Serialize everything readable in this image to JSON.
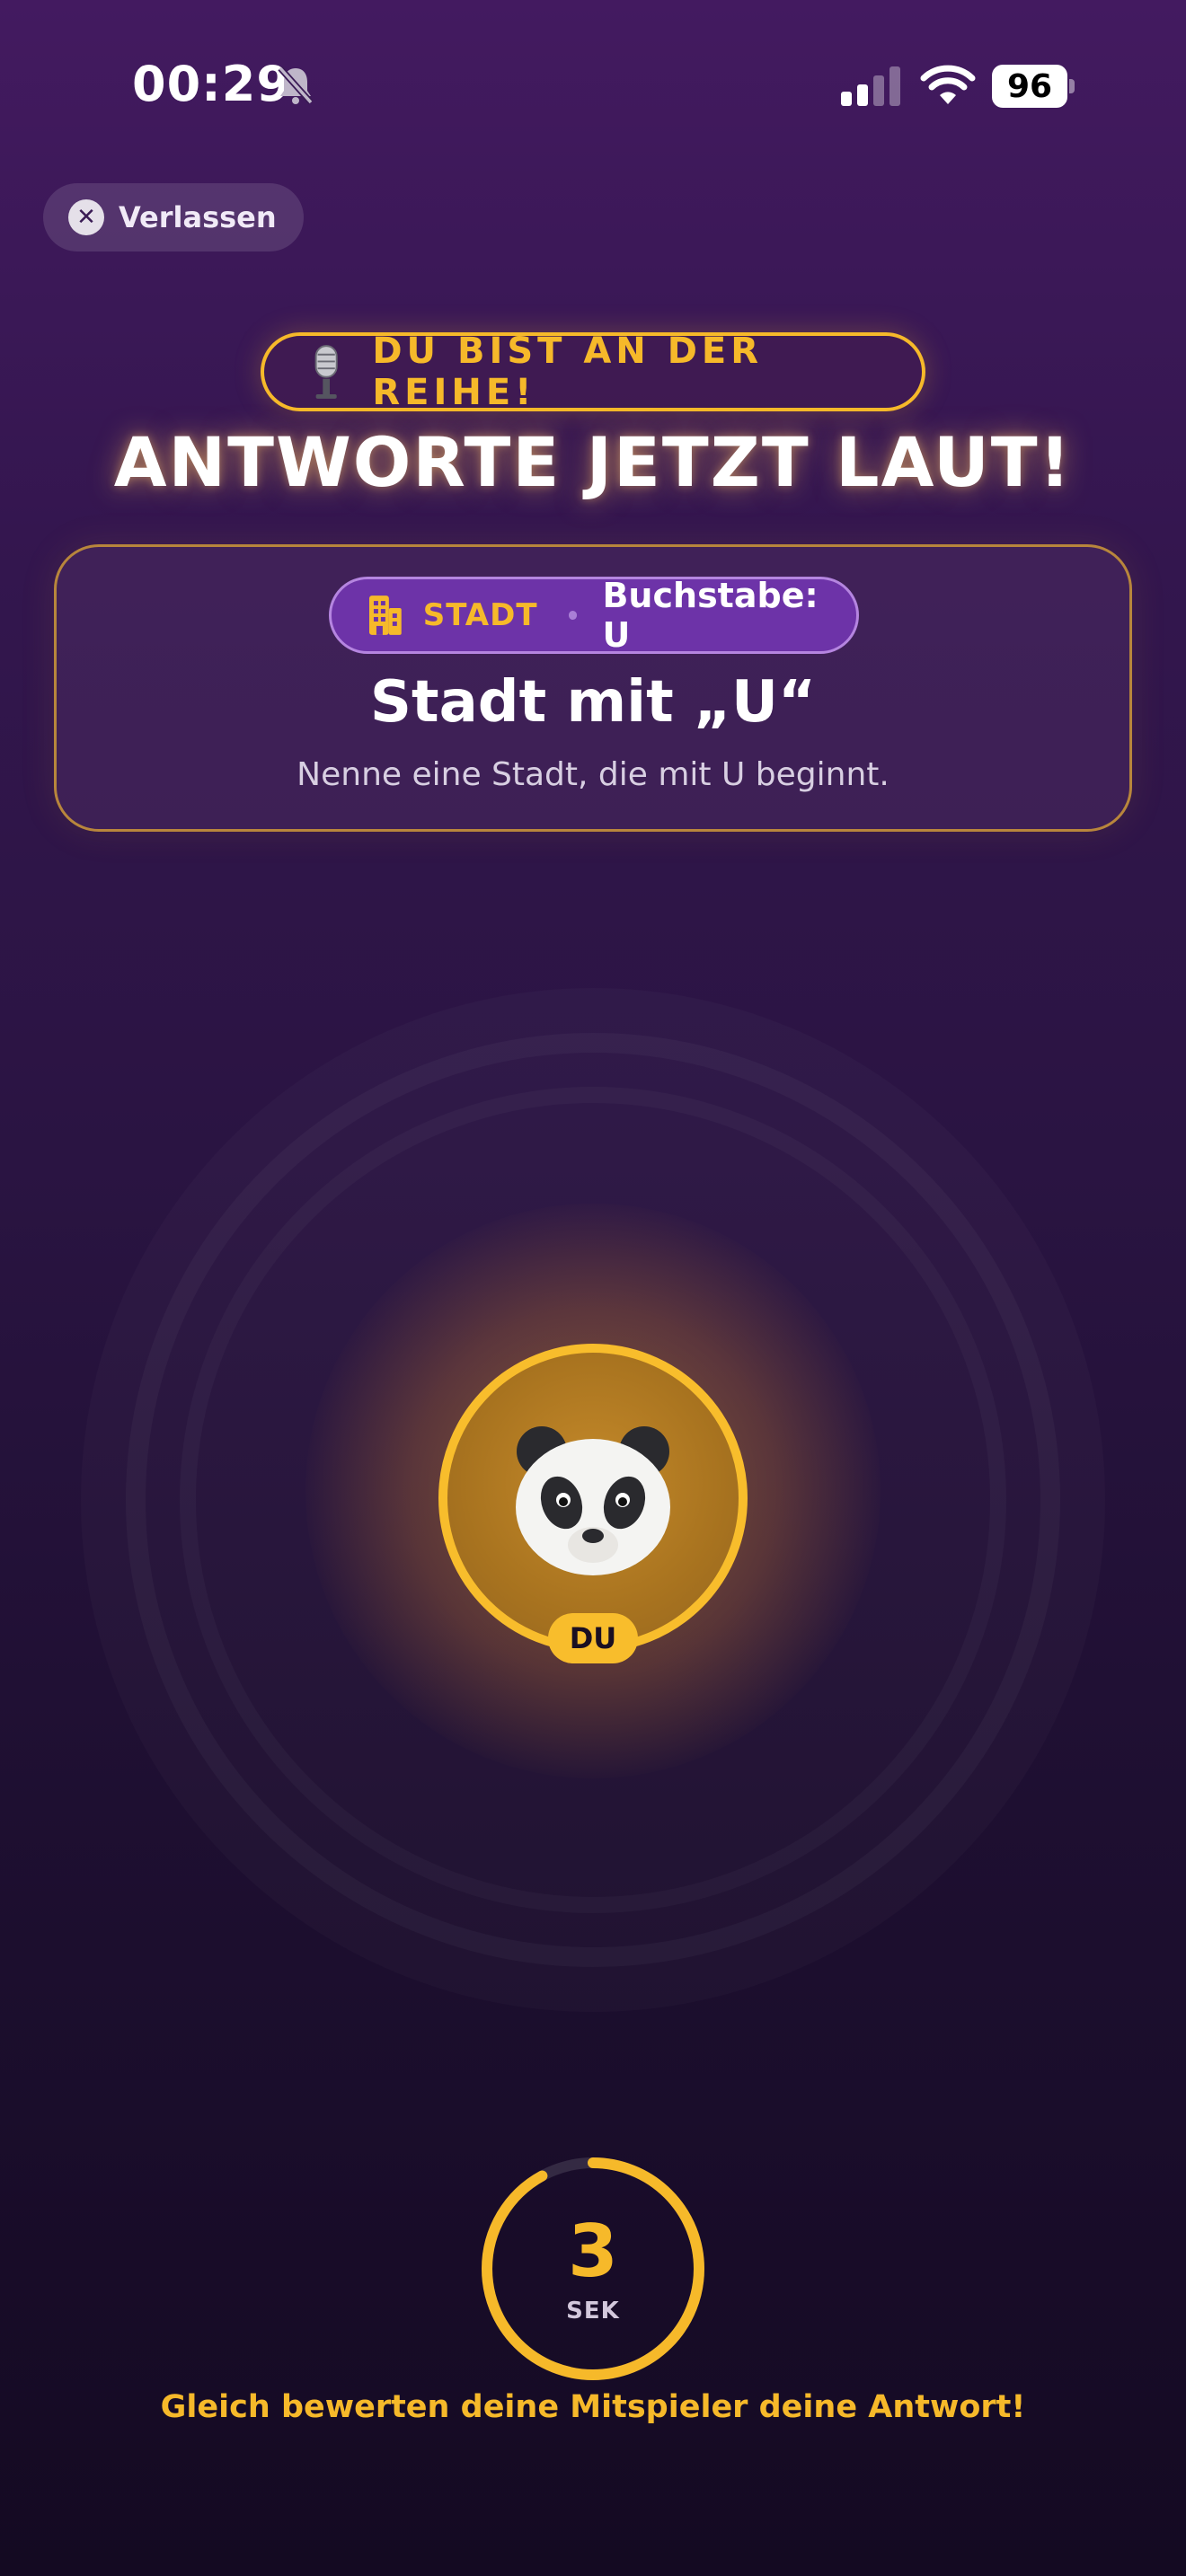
{
  "status_bar": {
    "time": "00:29",
    "battery": "96"
  },
  "leave_button": {
    "label": "Verlassen"
  },
  "turn": {
    "pill_text": "DU BIST AN DER REIHE!",
    "headline": "ANTWORTE JETZT LAUT!"
  },
  "prompt": {
    "category": "STADT",
    "letter_label": "Buchstabe: U",
    "title": "Stadt mit „U“",
    "subtitle": "Nenne eine Stadt, die mit U beginnt."
  },
  "player": {
    "avatar_emoji": "🐼",
    "badge": "DU"
  },
  "timer": {
    "seconds": "3",
    "unit": "SEK",
    "progress": 0.92
  },
  "footer": {
    "note": "Gleich bewerten deine Mitspieler deine Antwort!"
  },
  "colors": {
    "accent": "#f6b92a",
    "category_pill": "#6d33a8",
    "background_top": "#431a60",
    "background_bottom": "#140a22"
  }
}
